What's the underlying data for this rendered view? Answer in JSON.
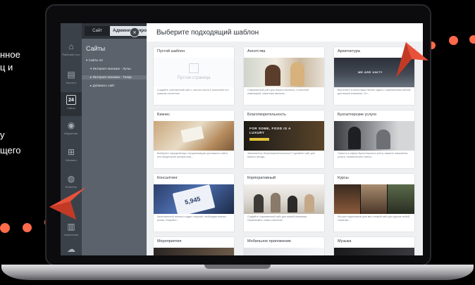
{
  "side_text": {
    "line1": "нное",
    "line2": "ц и",
    "line3": "у",
    "line4": "щего"
  },
  "colors": {
    "accent": "#ff6a4a",
    "rail": "#3b4149",
    "tree": "#5b626b"
  },
  "tabs": {
    "site": "Сайт",
    "admin": "Администрирование"
  },
  "rail_items": [
    {
      "label": "Рабочий стол",
      "icon": "home-icon"
    },
    {
      "label": "Контент",
      "icon": "document-icon"
    },
    {
      "label": "Сайты",
      "icon": "calendar-icon",
      "value": "24"
    },
    {
      "label": "Маркетинг",
      "icon": "target-icon"
    },
    {
      "label": "Магазин",
      "icon": "cart-icon"
    },
    {
      "label": "Клиенты",
      "icon": "users-icon"
    },
    {
      "label": "Аналитика",
      "icon": "analytics-icon"
    },
    {
      "label": "",
      "icon": "cloud-icon"
    }
  ],
  "tree": {
    "title": "Сайты",
    "rows": [
      "▾ Сайты 24",
      "▾ Интернет-магазин - Лучш",
      "▸ Интернет-магазин - Товар",
      "▸ Добавить сайт"
    ]
  },
  "main": {
    "title": "Выберите подходящий шаблон",
    "close": "×"
  },
  "templates": [
    {
      "title": "Пустой шаблон",
      "desc": "Создайте собственный сайт с чистого листа и наполните его нужным контентом.",
      "placeholder": "Пустая страница"
    },
    {
      "title": "Агентства",
      "desc": "Современный сайт для вашего бизнеса, с понятной навигацией, обратным звонком..."
    },
    {
      "title": "Архитектура",
      "desc": "Воплотите в жизнь ваше бизнес идею с современным сайтом для вашей компании. Он...",
      "overlay": "WE ARE UNITY"
    },
    {
      "title": "Бизнес",
      "desc": "Выберите определенную специализацию для вашего сайта или предложите разную инф..."
    },
    {
      "title": "Благотворительность",
      "desc": "Занимаетесь благотворительностью? Сделайте сайт для вашего фонда...",
      "overlay": "FOR SOME, FOOD IS A LUXURY"
    },
    {
      "title": "Бухгалтерские услуги",
      "desc": "Новости в сфере бухгалтерского учета, важные показатели, услуги, тематические статьи..."
    },
    {
      "title": "Консалтинг",
      "desc": "Качественный анализ и аудит, покупай, необходим анализ рынка. Разработ..."
    },
    {
      "title": "Корпоративный",
      "desc": "Создайте современный сайт для вашей компании. Привлекайте новых клиентов..."
    },
    {
      "title": "Курсы",
      "desc": "Мы уже подготовили для вас готовый сайт для курсов любой тематики..."
    },
    {
      "title": "Мероприятия",
      "desc": ""
    },
    {
      "title": "Мобильное приложение",
      "desc": ""
    },
    {
      "title": "Музыка",
      "desc": ""
    }
  ]
}
